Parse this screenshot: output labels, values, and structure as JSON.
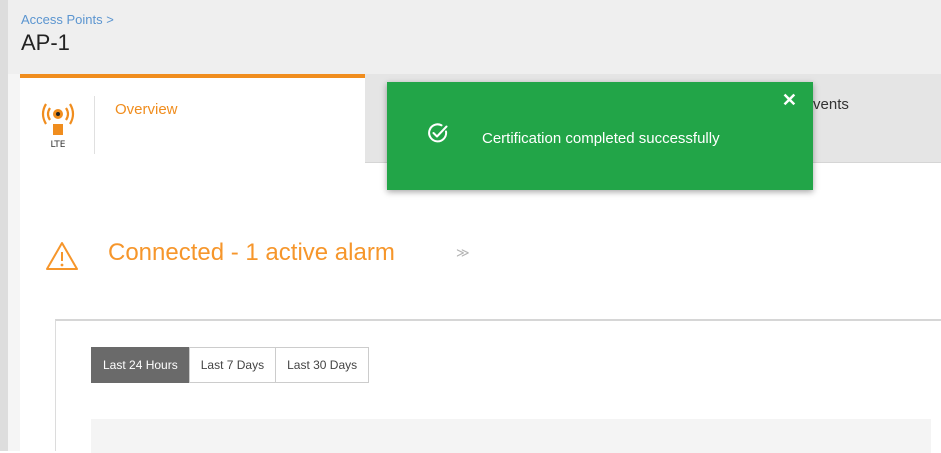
{
  "header": {
    "breadcrumb": "Access Points >",
    "title": "AP-1"
  },
  "tabs": {
    "overview": {
      "label": "Overview",
      "icon": "wireless-ap-icon",
      "icon_caption": "LTE"
    },
    "events": {
      "label": "Events"
    }
  },
  "status": {
    "text": "Connected - 1 active alarm",
    "icon": "warning-icon",
    "expand_glyph": "≫"
  },
  "time_range": {
    "options": [
      "Last 24 Hours",
      "Last 7 Days",
      "Last 30 Days"
    ],
    "selected": "Last 24 Hours"
  },
  "toast": {
    "message": "Certification completed successfully",
    "close_glyph": "✕",
    "icon": "check-circle-icon",
    "color": "#22a548"
  },
  "colors": {
    "accent": "#f08d1e",
    "link": "#5b95d0",
    "warning": "#f6962b"
  }
}
